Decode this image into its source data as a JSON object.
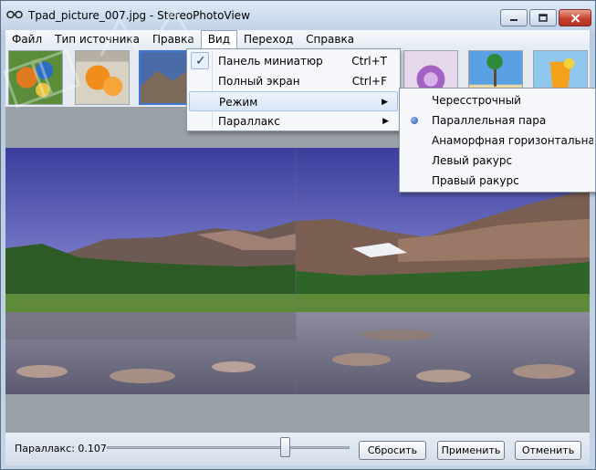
{
  "window": {
    "title": "Tpad_picture_007.jpg - StereoPhotoView",
    "title_icon": "stereo-glasses-icon",
    "controls": [
      "minimize-icon",
      "maximize-icon",
      "close-icon"
    ]
  },
  "menubar": {
    "items": [
      {
        "label": "Файл"
      },
      {
        "label": "Тип источника"
      },
      {
        "label": "Правка"
      },
      {
        "label": "Вид"
      },
      {
        "label": "Переход"
      },
      {
        "label": "Справка"
      }
    ]
  },
  "view_menu": {
    "items": [
      {
        "label": "Панель миниатюр",
        "shortcut": "Ctrl+T",
        "checked": true
      },
      {
        "label": "Полный экран",
        "shortcut": "Ctrl+F"
      },
      {
        "label": "Режим",
        "submenu": true
      },
      {
        "label": "Параллакс",
        "submenu": true
      }
    ],
    "arrow_glyph": "▶",
    "check_glyph": "✓"
  },
  "mode_menu": {
    "items": [
      {
        "label": "Чересстрочный"
      },
      {
        "label": "Параллельная пара",
        "selected": true
      },
      {
        "label": "Анаморфная горизонтальная пар"
      },
      {
        "label": "Левый ракурс"
      },
      {
        "label": "Правый ракурс"
      }
    ]
  },
  "thumbnails": {
    "count": 10,
    "selected_index": 2
  },
  "controls": {
    "parallax_label": "Параллакс: 0.107",
    "slider_value": 0.74,
    "reset_label": "Сбросить",
    "apply_label": "Применить",
    "cancel_label": "Отменить"
  },
  "colors": {
    "accent": "#3c78d8",
    "menu_highlight": "#d9e6f7",
    "close_button": "#c7432f"
  }
}
